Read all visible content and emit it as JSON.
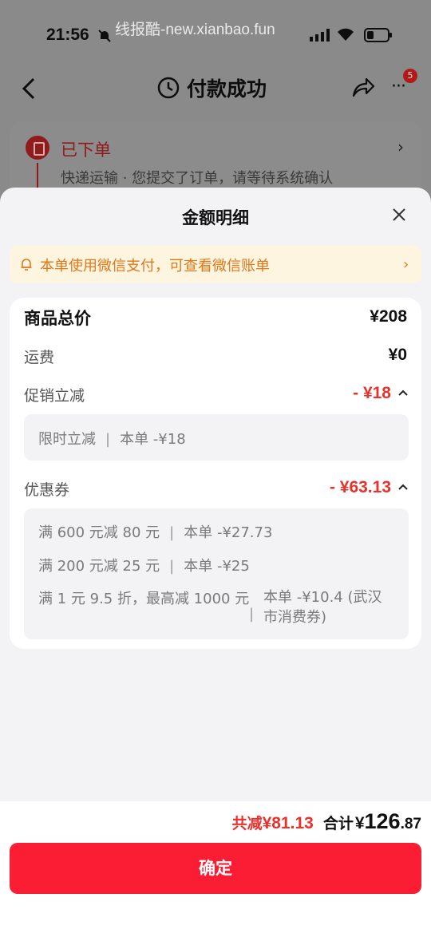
{
  "status_bar": {
    "time": "21:56",
    "watermark": "线报酷-new.xianbao.fun"
  },
  "nav": {
    "title": "付款成功",
    "badge_count": "5"
  },
  "order": {
    "status": "已下单",
    "description": "快递运输 · 您提交了订单，请等待系统确认"
  },
  "sheet": {
    "title": "金额明细",
    "notice": "本单使用微信支付，可查看微信账单",
    "rows": {
      "goods_total_label": "商品总价",
      "goods_total_value": "¥208",
      "shipping_label": "运费",
      "shipping_value": "¥0",
      "promo_label": "促销立减",
      "promo_value": "- ¥18",
      "coupon_label": "优惠券",
      "coupon_value": "- ¥63.13"
    },
    "promo_details": [
      {
        "name": "限时立减",
        "amount": "本单 -¥18"
      }
    ],
    "coupon_details": [
      {
        "name": "满 600 元减 80 元",
        "amount": "本单 -¥27.73"
      },
      {
        "name": "满 200 元减 25 元",
        "amount": "本单 -¥25"
      },
      {
        "name": "满 1 元 9.5 折，最高减 1000 元",
        "amount_line1": "本单 -¥10.4 (武汉",
        "amount_line2": "市消费券)"
      }
    ]
  },
  "footer": {
    "discount_label": "共减",
    "discount_value": "¥81.13",
    "total_label": "合计",
    "total_currency": "¥",
    "total_int": "126",
    "total_dec": ".87",
    "confirm_label": "确定"
  },
  "colors": {
    "accent_red": "#fb1d33",
    "discount_red": "#e8322d",
    "notice_orange": "#e0781a"
  }
}
